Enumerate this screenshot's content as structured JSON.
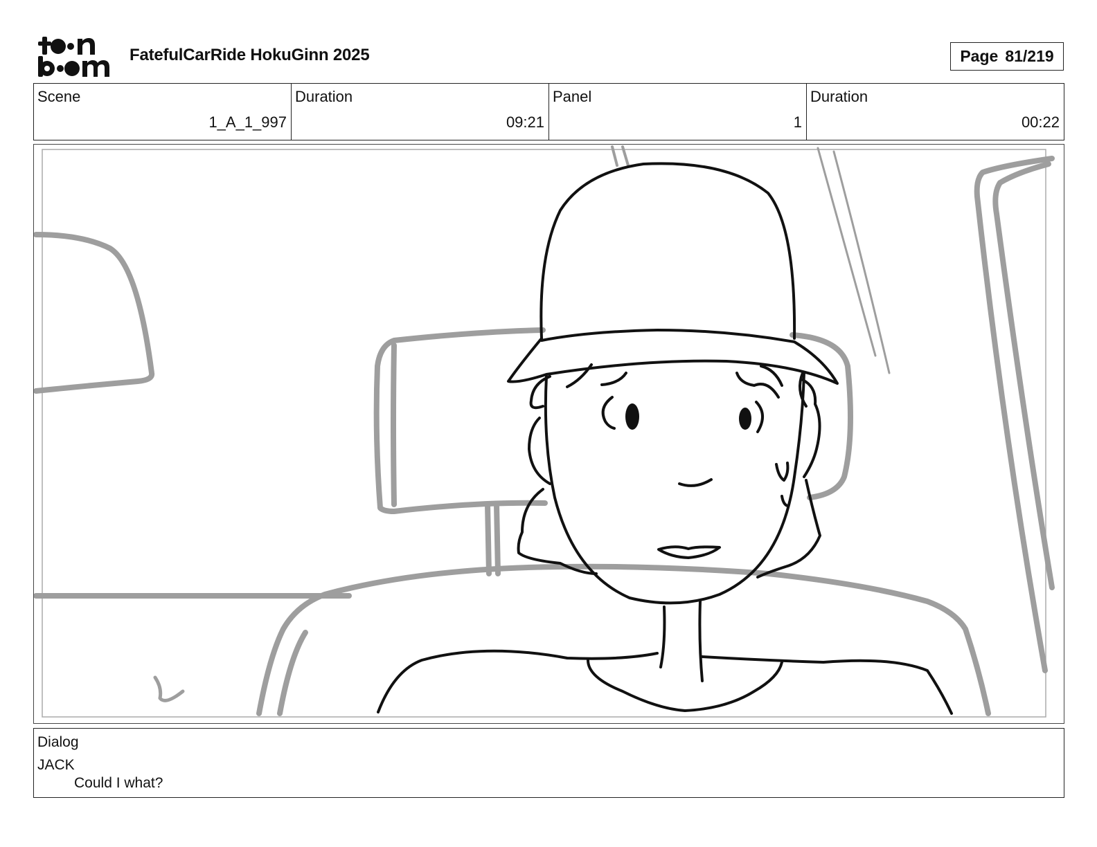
{
  "header": {
    "logo_alt": "toon boom",
    "title": "FatefulCarRide HokuGinn 2025",
    "page_label": "Page",
    "page_value": "81/219"
  },
  "info": {
    "scene_label": "Scene",
    "scene_value": "1_A_1_997",
    "scene_duration_label": "Duration",
    "scene_duration_value": "09:21",
    "panel_label": "Panel",
    "panel_value": "1",
    "panel_duration_label": "Duration",
    "panel_duration_value": "00:22"
  },
  "dialog": {
    "label": "Dialog",
    "speaker": "JACK",
    "line": "Could I what?"
  },
  "colors": {
    "ink": "#111111",
    "background_lines": "#9e9e9e"
  }
}
